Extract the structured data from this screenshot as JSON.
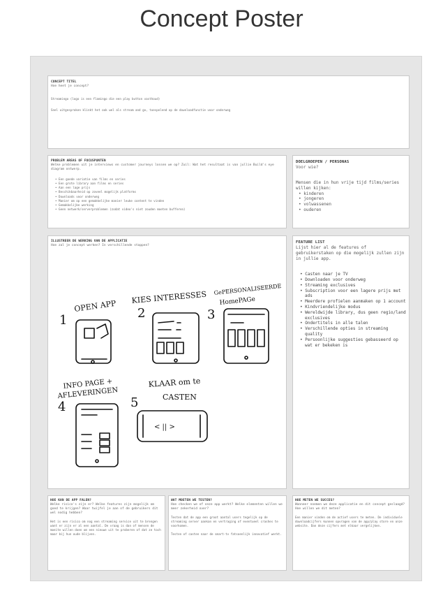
{
  "page": {
    "title": "Concept Poster"
  },
  "concept": {
    "heading": "CONCEPT TITEL",
    "question": "Hoe heet je concept?",
    "line1": "Streamingo (logo is een flamingo die een play button vasthoud)",
    "line2": "Snel uitgesproken klinkt het ook wel als stream and go, toespelend op de downloadfunctie voor onderweg"
  },
  "problem": {
    "heading": "PROBLEM AREAS of FOCUSPUNTEN",
    "question": "Welke problemen uit je interviews en customer journeys lossen we op? Zuil: Wat het resultaat is van jullie Build's eye diagram ontwerp.",
    "items": [
      "Een goede variatie van films en series",
      "Een grote library aan films en series",
      "Aan een lage prijs",
      "Beschikbaarheid op zoveel mogelijk platforms",
      "Downloads voor onderweg",
      "Manier om op een gemakkelijke manier leuke content te vinden",
      "Gemakkelijke werking",
      "Geen netwerk/serverproblemen (zodat video's niet zouden moeten bufferen)"
    ]
  },
  "personas": {
    "heading": "DOELGROEPEN / PERSONAS",
    "question": "Voor wie?",
    "intro": "Mensen die in hun vrije tijd films/series willen kijken:",
    "items": [
      "kinderen",
      "jongeren",
      "volwassenen",
      "ouderen"
    ]
  },
  "illustration": {
    "heading": "ILLUSTREER DE WERKING VAN DE APPLICATIE",
    "question": "Hoe zal je concept werken? In verschillende stappen?",
    "steps": [
      {
        "num": "1",
        "label": "OPEN APP"
      },
      {
        "num": "2",
        "label": "KIES INTERESSES"
      },
      {
        "num": "3",
        "label_line1": "GePERSONALISEERDE",
        "label_line2": "HomePAGe"
      },
      {
        "num": "4",
        "label_line1": "INFO PAGE +",
        "label_line2": "AFLEVERINGEN"
      },
      {
        "num": "5",
        "label_line1": "KLAAR om te",
        "label_line2": "CASTEN"
      }
    ],
    "player_glyph": "< || >"
  },
  "features": {
    "heading": "FEATURE LIST",
    "question": "Lijst hier al de features of gebruikerstaken op die mogelijk zullen zijn in jullie app.",
    "items": [
      "Casten naar je TV",
      "Downloaden voor onderweg",
      "Streaming exclusives",
      "Subscription voor een lagere prijs met ads",
      "Meerdere profielen aanmaken op 1 account",
      "Kindvriendelijke modus",
      "Wereldwijde library, dus geen regio/land exclusives",
      "Ondertitels in alle talen",
      "Verschillende opties in streaming quality",
      "Persoonlijke suggesties gebasseerd op wat er bekeken is"
    ]
  },
  "fail": {
    "heading": "HOE KAN DE APP FALEN?",
    "question": "Welke risico's zijn er? Welke features zijn mogelijk om goed te krijgen? Waar twijfel je aan of de gebruikers dit wel nodig hebben?",
    "body": "Het is een risico om nog een streaming service uit te brengen want er zijn er al een aantal. De vraag is dan of mensen de moeite willen doen om een nieuwe uit te proberen of dat ze toch maar bij hun oude blijven."
  },
  "test": {
    "heading": "WAT MOETEN WE TESTEN?",
    "question": "Hoe checken we of onze app werkt? Welke elementen willen we meer zekerheid over?",
    "body1": "Testen dat de app een groot aantal users tegelijk op de streaming server aankan en vertraging of eventueel crashes te voorkomen.",
    "body2": "Testen of casten naar de smart-tv fatsoenlijk innovatief werkt."
  },
  "measure": {
    "heading": "HOE METEN WE SUCCES?",
    "question": "Wanneer noemen we deze applicatie en dit concept geslaagd? Hoe willen we dit meten?",
    "body": "Een manier vinden om de actief users te meten. De individuele downloadcijfers kunnen opvragen van de app/play store en onze website. Dan deze cijfers met elkaar vergelijken."
  }
}
